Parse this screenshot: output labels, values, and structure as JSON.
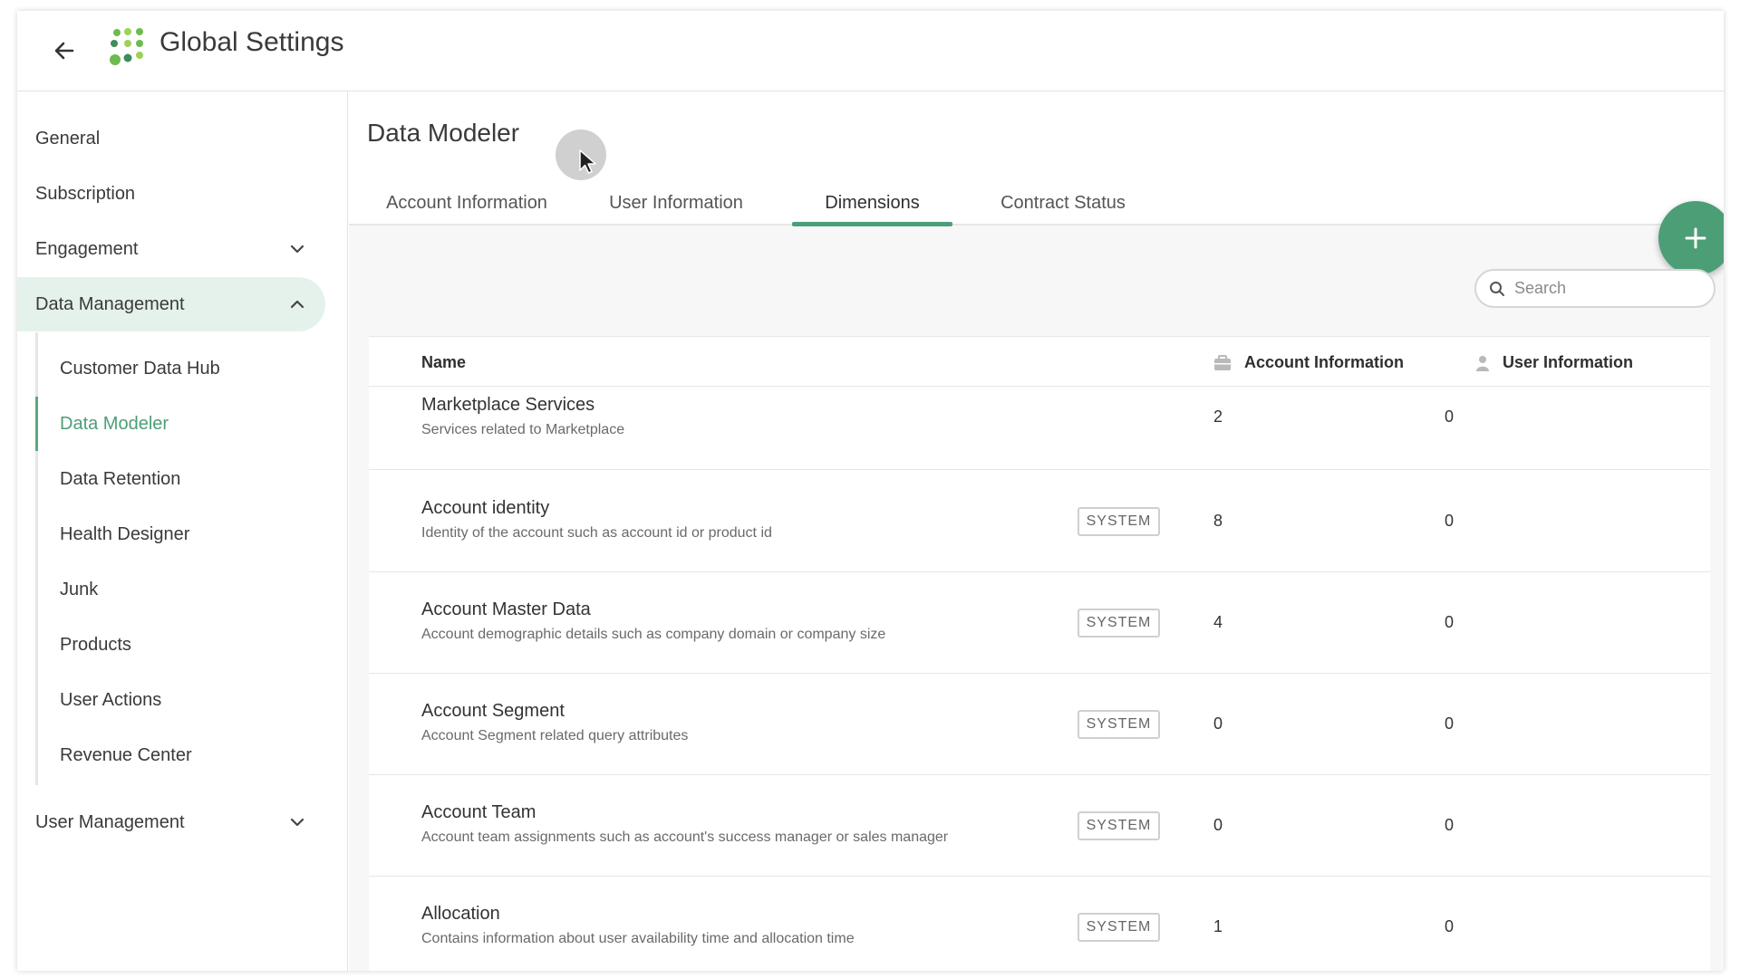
{
  "header": {
    "title": "Global Settings",
    "back_icon": "arrow-left-icon",
    "logo_colors": [
      "#3e8e5a",
      "#6dbb4f",
      "#9fd05a"
    ]
  },
  "sidebar": {
    "items": [
      {
        "label": "General"
      },
      {
        "label": "Subscription"
      },
      {
        "label": "Engagement",
        "icon": "chevron-down-icon"
      },
      {
        "label": "Data Management",
        "icon": "chevron-up-icon",
        "expanded": true
      },
      {
        "label": "User Management",
        "icon": "chevron-down-icon"
      }
    ],
    "sub_items": [
      {
        "label": "Customer Data Hub"
      },
      {
        "label": "Data Modeler",
        "active": true
      },
      {
        "label": "Data Retention"
      },
      {
        "label": "Health Designer"
      },
      {
        "label": "Junk"
      },
      {
        "label": "Products"
      },
      {
        "label": "User Actions"
      },
      {
        "label": "Revenue Center"
      }
    ]
  },
  "main": {
    "title": "Data Modeler",
    "tabs": [
      {
        "label": "Account Information"
      },
      {
        "label": "User Information"
      },
      {
        "label": "Dimensions",
        "active": true
      },
      {
        "label": "Contract Status"
      }
    ],
    "add_icon": "plus-icon",
    "search": {
      "placeholder": "Search",
      "icon": "search-icon"
    },
    "table": {
      "headers": {
        "name": "Name",
        "account_info": "Account Information",
        "user_info": "User Information",
        "account_icon": "briefcase-icon",
        "user_icon": "person-icon"
      },
      "rows": [
        {
          "name": "Marketplace Services",
          "desc": "Services related to Marketplace",
          "badge": "",
          "account_count": "2",
          "user_count": "0"
        },
        {
          "name": "Account identity",
          "desc": "Identity of the account such as account id or product id",
          "badge": "SYSTEM",
          "account_count": "8",
          "user_count": "0"
        },
        {
          "name": "Account Master Data",
          "desc": "Account demographic details such as company domain or company size",
          "badge": "SYSTEM",
          "account_count": "4",
          "user_count": "0"
        },
        {
          "name": "Account Segment",
          "desc": "Account Segment related query attributes",
          "badge": "SYSTEM",
          "account_count": "0",
          "user_count": "0"
        },
        {
          "name": "Account Team",
          "desc": "Account team assignments such as account's success manager or sales manager",
          "badge": "SYSTEM",
          "account_count": "0",
          "user_count": "0"
        },
        {
          "name": "Allocation",
          "desc": "Contains information about user availability time and allocation time",
          "badge": "SYSTEM",
          "account_count": "1",
          "user_count": "0"
        }
      ]
    }
  },
  "colors": {
    "accent": "#4c9e77",
    "active_bg": "#e5f2ec"
  }
}
